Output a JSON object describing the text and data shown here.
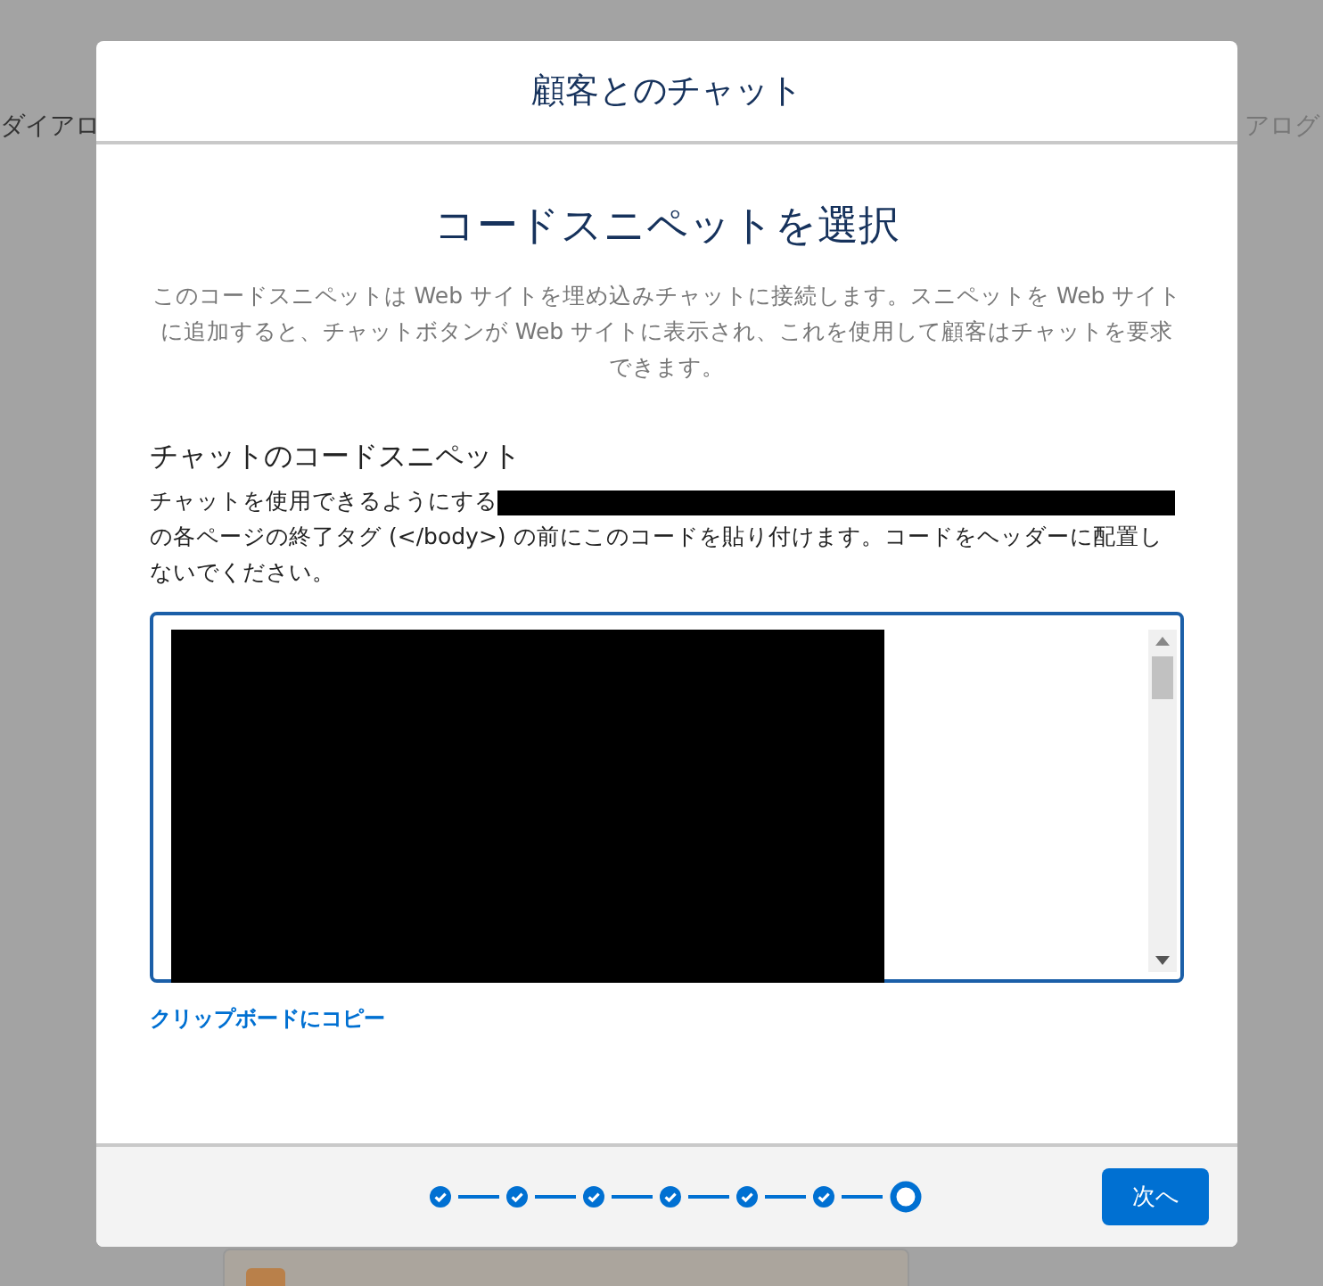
{
  "background": {
    "left_text": "ダイアロ",
    "right_text": "アログ"
  },
  "dialog": {
    "title": "顧客とのチャット",
    "heading": "コードスニペットを選択",
    "description": "このコードスニペットは Web サイトを埋め込みチャットに接続します。スニペットを Web サイトに追加すると、チャットボタンが Web サイトに表示され、これを使用して顧客はチャットを要求できます。",
    "section_title": "チャットのコードスニペット",
    "instruction_start": "チャットを使用できるようにする",
    "instruction_end": "の各ページの終了タグ (</body>) の前にこのコードを貼り付けます。コードをヘッダーに配置しないでください。",
    "copy_link": "クリップボードにコピー",
    "steps": [
      {
        "completed": true
      },
      {
        "completed": true
      },
      {
        "completed": true
      },
      {
        "completed": true
      },
      {
        "completed": true
      },
      {
        "completed": true
      },
      {
        "completed": false
      }
    ],
    "next_button": "次へ"
  }
}
